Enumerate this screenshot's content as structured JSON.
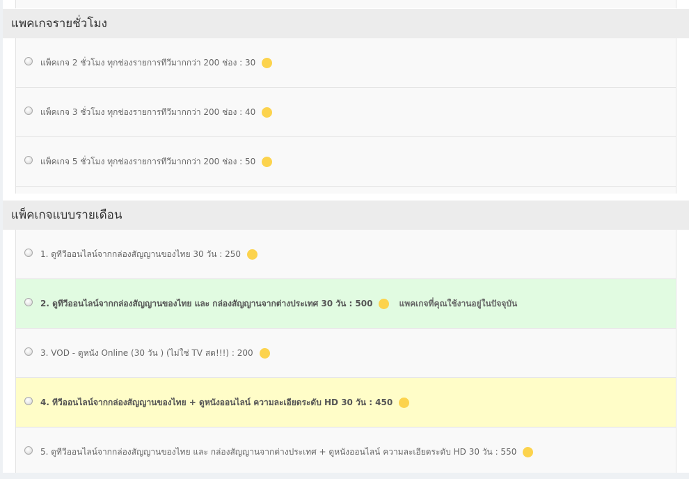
{
  "colors": {
    "coin": "#fcd34d",
    "current_row_bg": "#e1fbe1",
    "highlight_row_bg": "#fffdc8",
    "row_bg": "#f9f9f9",
    "header_bg": "#ececec"
  },
  "hourly": {
    "title": "แพคเกจรายชั่วโมง",
    "items": [
      {
        "label": "แพ็คเกจ 2 ชั่วโมง ทุกช่องรายการทีวีมากกว่า 200 ช่อง : 30",
        "icon": "coin-icon"
      },
      {
        "label": "แพ็คเกจ 3 ชั่วโมง ทุกช่องรายการทีวีมากกว่า 200 ช่อง : 40",
        "icon": "coin-icon"
      },
      {
        "label": "แพ็คเกจ 5 ชั่วโมง ทุกช่องรายการทีวีมากกว่า 200 ช่อง : 50",
        "icon": "coin-icon"
      }
    ]
  },
  "monthly": {
    "title": "แพ็คเกจแบบรายเดือน",
    "items": [
      {
        "label": "1. ดูทีวีออนไลน์จากกล่องสัญญานของไทย 30 วัน : 250",
        "icon": "coin-icon"
      },
      {
        "label": "2. ดูทีวีออนไลน์จากกล่องสัญญานของไทย และ กล่องสัญญานจากต่างประเทศ 30 วัน : 500",
        "icon": "coin-icon",
        "note": "แพคเกจที่คุณใช้งานอยู่ในปัจจุบัน"
      },
      {
        "label": "3. VOD - ดูหนัง Online (30 วัน ) (ไม่ใช่ TV สด!!!) : 200",
        "icon": "coin-icon"
      },
      {
        "label": "4. ทีวีออนไลน์จากกล่องสัญญานของไทย + ดูหนังออนไลน์ ความละเอียดระดับ HD 30 วัน : 450",
        "icon": "coin-icon"
      },
      {
        "label": "5. ดูทีวีออนไลน์จากกล่องสัญญานของไทย และ กล่องสัญญานจากต่างประเทศ + ดูหนังออนไลน์ ความละเอียดระดับ HD 30 วัน : 550",
        "icon": "coin-icon"
      }
    ]
  }
}
